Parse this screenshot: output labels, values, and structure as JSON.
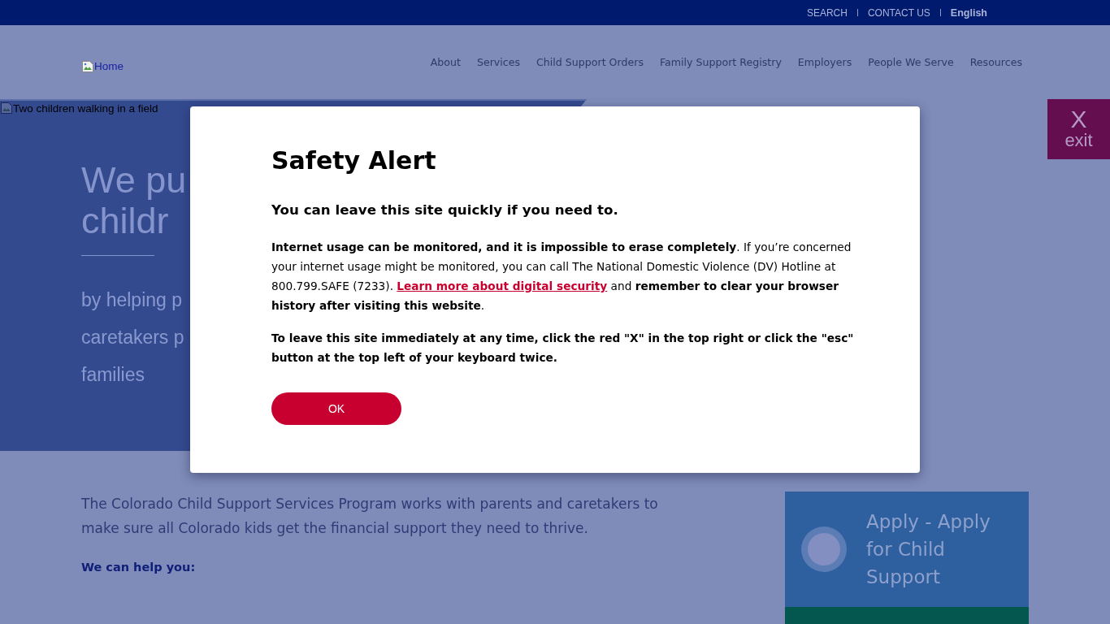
{
  "top_bar": {
    "links": [
      {
        "label": "SEARCH",
        "kind": "link"
      },
      {
        "label": "CONTACT US",
        "kind": "link"
      },
      {
        "label": "English",
        "kind": "language"
      }
    ]
  },
  "header": {
    "logo_alt": "Home",
    "nav": [
      "About",
      "Services",
      "Child Support Orders",
      "Family Support Registry",
      "Employers",
      "People We Serve",
      "Resources"
    ]
  },
  "hero": {
    "image_alt": "Two children walking in a field",
    "heading_lines": [
      "We pu",
      "childr"
    ],
    "subtext_lines": [
      "by helping p",
      "caretakers p",
      "families"
    ]
  },
  "exit_button": {
    "mark": "X",
    "label": "exit"
  },
  "intro": {
    "text": "The Colorado Child Support Services Program works with parents and caretakers to make sure all Colorado kids get the financial support they need to thrive.",
    "subheading": "We can help you:"
  },
  "apply_card": {
    "label": "Apply - Apply for Child Support"
  },
  "modal": {
    "title": "Safety Alert",
    "subtitle": "You can leave this site quickly if you need to.",
    "message": {
      "before": "**Internet usage can be monitored, and it is impossible to erase completely**. If you’re concerned your internet usage might be monitored, you can call The National Domestic Violence (DV) Hotline at 800.799.SAFE (7233). ",
      "link": "Learn more about digital security",
      "after": " and **remember to clear your browser history after visiting this website**."
    },
    "instruction": "To leave this site immediately at any time, click the red \"X\" in the top right or click the \"esc\" button at the top left of your keyboard twice.",
    "ok_button": "OK"
  }
}
